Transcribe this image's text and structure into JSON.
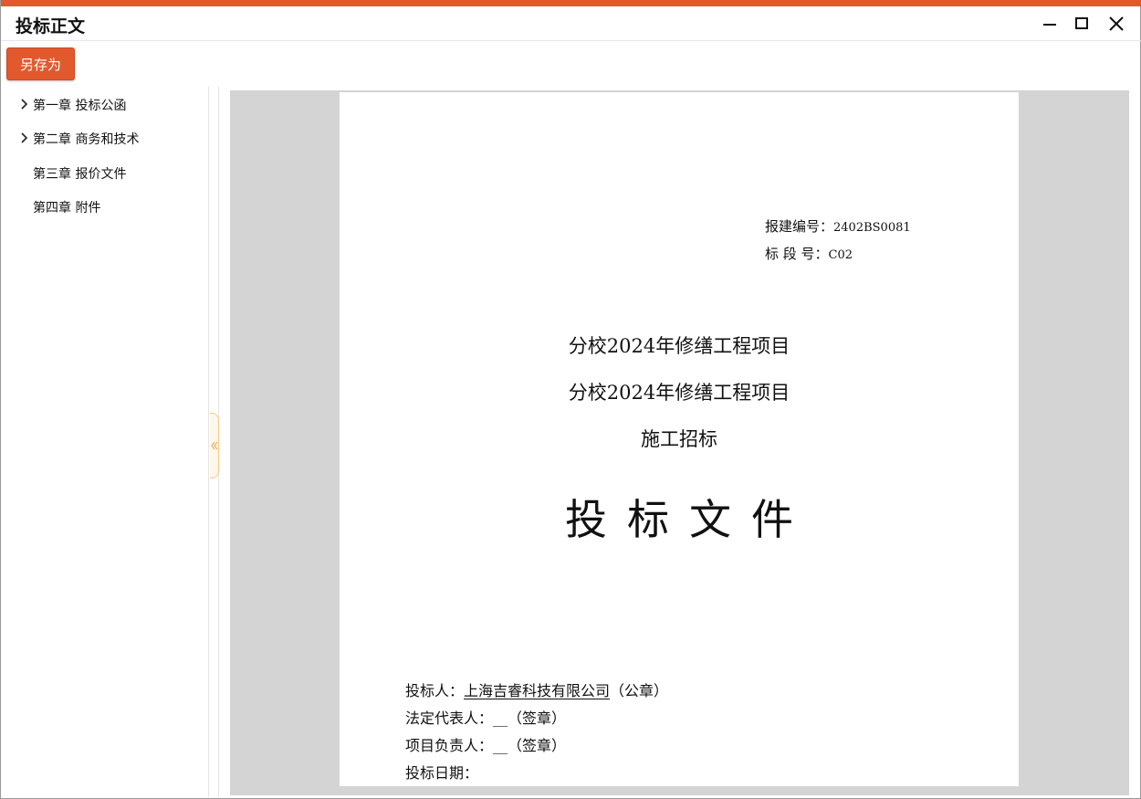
{
  "window": {
    "title": "投标正文",
    "accent_color": "#e2592e",
    "controls": [
      "minimize-icon",
      "maximize-icon",
      "close-icon"
    ]
  },
  "toolbar": {
    "save_as_label": "另存为"
  },
  "sidebar": {
    "items": [
      {
        "label": "第一章 投标公函",
        "expandable": true
      },
      {
        "label": "第二章 商务和技术",
        "expandable": true
      },
      {
        "label": "第三章 报价文件",
        "expandable": false
      },
      {
        "label": "第四章 附件",
        "expandable": false
      }
    ],
    "collapse_icon": "double-chevron-left-icon"
  },
  "document": {
    "meta": {
      "build_no_label": "报建编号：",
      "build_no_value": "2402BS0081",
      "section_no_label": "标 段 号：",
      "section_no_value": "C02"
    },
    "project_line_1": "分校2024年修缮工程项目",
    "project_line_2": "分校2024年修缮工程项目",
    "project_line_3": "施工招标",
    "doc_title": "投标文件",
    "signatures": {
      "bidder_label": "投标人：",
      "bidder_value": "上海吉睿科技有限公司",
      "bidder_suffix": "（公章）",
      "legal_rep_label": "法定代表人：",
      "legal_rep_blank": "__",
      "legal_rep_suffix": "（签章）",
      "project_lead_label": "项目负责人：",
      "project_lead_blank": "__",
      "project_lead_suffix": "（签章）",
      "bid_date_label": "投标日期："
    }
  }
}
